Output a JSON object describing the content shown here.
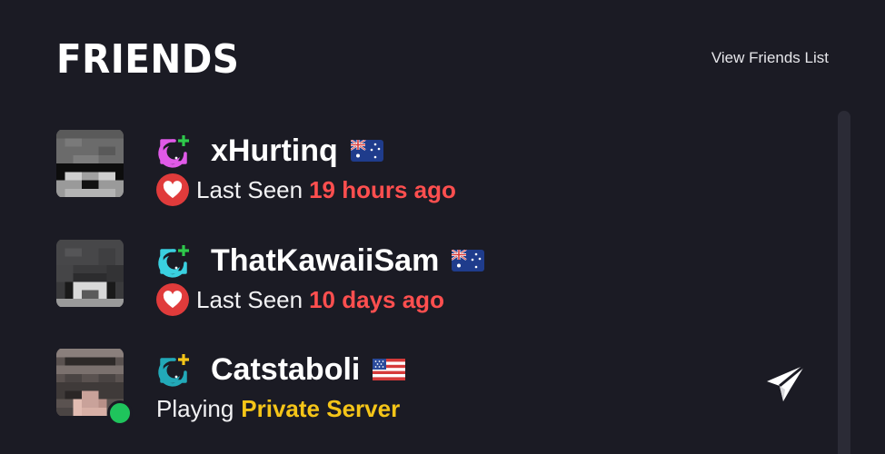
{
  "header": {
    "title": "FRIENDS",
    "view_link": "View Friends List"
  },
  "friends": [
    {
      "username": "xHurtinq",
      "rank_icon": "moon-rank-icon",
      "rank_color": "#e05ae8",
      "flag": "australia-flag",
      "status_label": "Last Seen",
      "status_value": "19 hours ago"
    },
    {
      "username": "ThatKawaiiSam",
      "rank_icon": "moon-rank-icon",
      "rank_color": "#3ad0e0",
      "flag": "australia-flag",
      "status_label": "Last Seen",
      "status_value": "10 days ago"
    },
    {
      "username": "Catstaboli",
      "rank_icon": "moon-rank-icon",
      "rank_color": "#22a9b8",
      "flag": "usa-flag",
      "status_label": "Playing",
      "status_value": "Private Server",
      "online": true
    }
  ],
  "colors": {
    "background": "#1b1b24",
    "last_seen": "#ff4f4f",
    "playing_server": "#f5c518",
    "online": "#1fc45c"
  }
}
